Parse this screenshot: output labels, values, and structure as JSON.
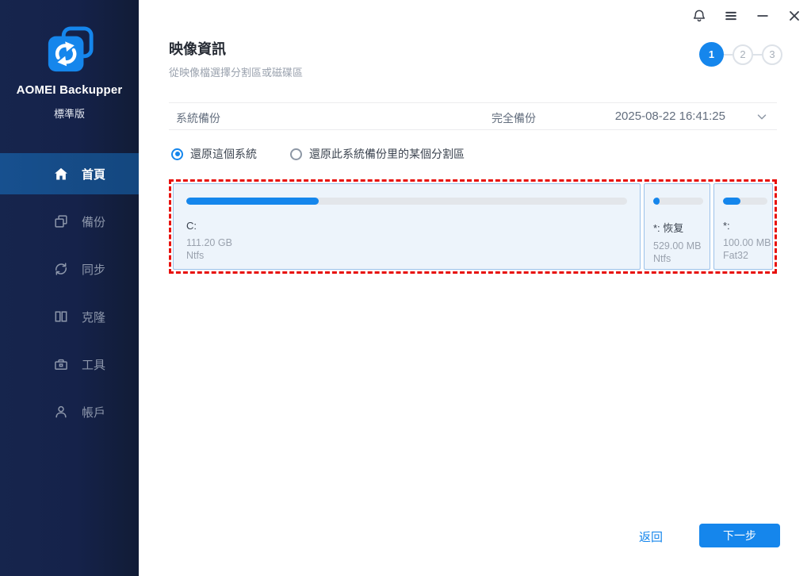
{
  "app": {
    "name": "AOMEI Backupper",
    "edition": "標準版"
  },
  "titlebar": {
    "icons": [
      "bell",
      "menu",
      "minimize",
      "close"
    ]
  },
  "sidebar": {
    "items": [
      {
        "label": "首頁",
        "icon": "home-icon",
        "active": true
      },
      {
        "label": "備份",
        "icon": "backup-icon",
        "active": false
      },
      {
        "label": "同步",
        "icon": "sync-icon",
        "active": false
      },
      {
        "label": "克隆",
        "icon": "clone-icon",
        "active": false
      },
      {
        "label": "工具",
        "icon": "tools-icon",
        "active": false
      },
      {
        "label": "帳戶",
        "icon": "account-icon",
        "active": false
      }
    ]
  },
  "header": {
    "title": "映像資訊",
    "subtitle": "從映像檔選擇分割區或磁碟區"
  },
  "steps": {
    "items": [
      {
        "label": "1",
        "active": true
      },
      {
        "label": "2",
        "active": false
      },
      {
        "label": "3",
        "active": false
      }
    ]
  },
  "backup_row": {
    "name": "系統備份",
    "type": "完全備份",
    "timestamp": "2025-08-22 16:41:25"
  },
  "restore_options": [
    {
      "label": "還原這個系統",
      "selected": true
    },
    {
      "label": "還原此系統備份里的某個分割區",
      "selected": false
    }
  ],
  "disk": {
    "partitions": [
      {
        "label": "C:",
        "size": "111.20 GB",
        "filesystem": "Ntfs",
        "used_percent": 30
      },
      {
        "label": "*: 恢复",
        "size": "529.00 MB",
        "filesystem": "Ntfs",
        "used_percent": 13
      },
      {
        "label": "*:",
        "size": "100.00 MB",
        "filesystem": "Fat32",
        "used_percent": 40
      }
    ]
  },
  "footer": {
    "back_label": "返回",
    "next_label": "下一步"
  },
  "colors": {
    "accent": "#1586ec",
    "sidebar_active": "#164a86",
    "disk_highlight_border": "#e8100c",
    "partition_bg": "#edf4fb",
    "partition_border": "#9cc2ea"
  }
}
